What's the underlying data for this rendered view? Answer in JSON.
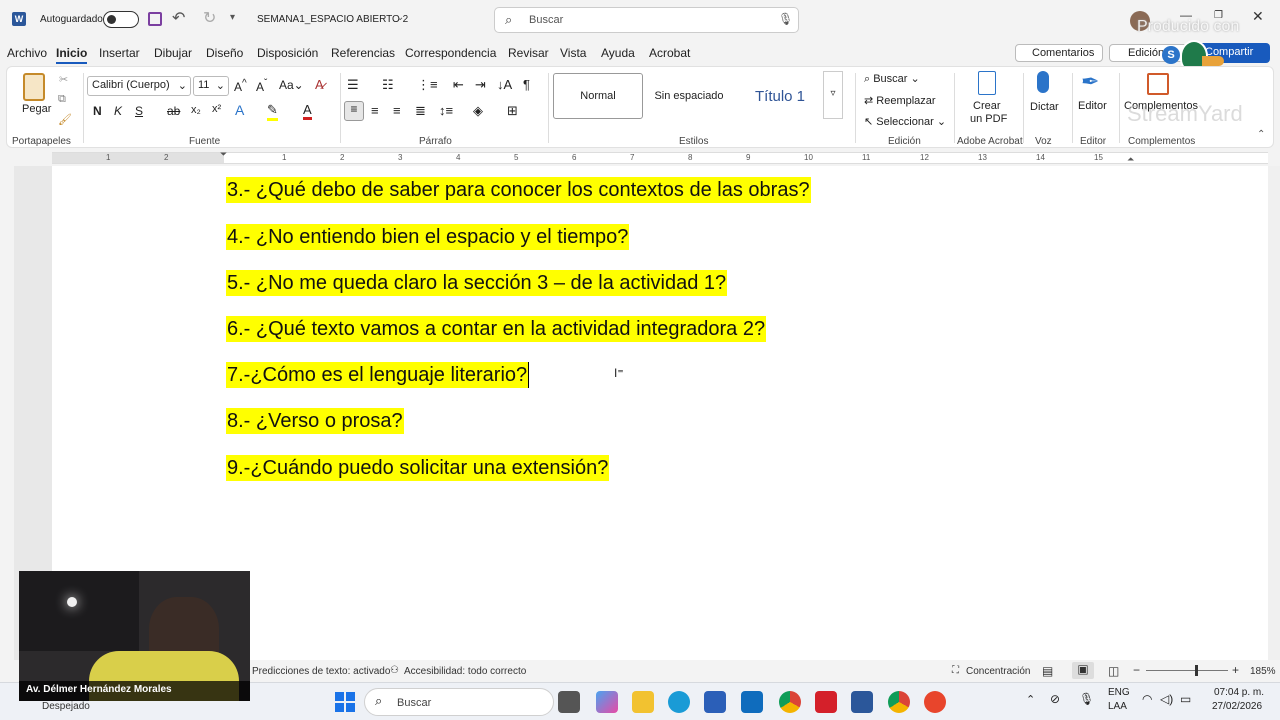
{
  "titlebar": {
    "autosave_label": "Autoguardado",
    "doc_title": "SEMANA1_ESPACIO ABIERTO 2",
    "search_placeholder": "Buscar",
    "watermark": "Producido con",
    "watermark2": "StreamYard"
  },
  "menu": [
    "Archivo",
    "Inicio",
    "Insertar",
    "Dibujar",
    "Diseño",
    "Disposición",
    "Referencias",
    "Correspondencia",
    "Revisar",
    "Vista",
    "Ayuda",
    "Acrobat"
  ],
  "menu_right": {
    "comments": "Comentarios",
    "editing": "Edición",
    "share": "Compartir"
  },
  "ribbon": {
    "paste": "Pegar",
    "clipboard_group": "Portapapeles",
    "font_name": "Calibri (Cuerpo)",
    "font_size": "11",
    "font_group": "Fuente",
    "paragraph_group": "Párrafo",
    "styles": [
      "Normal",
      "Sin espaciado",
      "Título 1"
    ],
    "styles_group": "Estilos",
    "find": "Buscar",
    "replace": "Reemplazar",
    "select": "Seleccionar",
    "editing_group": "Edición",
    "create_pdf_1": "Crear",
    "create_pdf_2": "un PDF",
    "acrobat_group": "Adobe Acrobat",
    "dictate": "Dictar",
    "voice_group": "Voz",
    "editor": "Editor",
    "editor_group": "Editor",
    "addins": "Complementos",
    "addins_group": "Complementos"
  },
  "ruler_numbers": [
    "1",
    "2",
    "1",
    "2",
    "3",
    "4",
    "5",
    "6",
    "7",
    "8",
    "9",
    "10",
    "11",
    "12",
    "13",
    "14",
    "15"
  ],
  "document": {
    "lines": [
      "3.- ¿Qué debo de saber para conocer los contextos de las obras?",
      "4.- ¿No entiendo bien el espacio y el tiempo?",
      "5.- ¿No me queda claro la sección 3 – de la actividad 1?",
      "6.- ¿Qué texto vamos a contar en la actividad integradora 2?",
      "7.-¿Cómo es el lenguaje literario?",
      "8.- ¿Verso o prosa?",
      "9.-¿Cuándo puedo solicitar una extensión?"
    ]
  },
  "statusbar": {
    "text_predictions": "Predicciones de texto: activado",
    "accessibility": "Accesibilidad: todo correcto",
    "focus": "Concentración",
    "zoom": "185%"
  },
  "webcam": {
    "name": "Av. Délmer Hernández Morales"
  },
  "taskbar": {
    "weather": "Despejado",
    "search": "Buscar",
    "lang_1": "ENG",
    "lang_2": "LAA",
    "time": "07:04 p. m.",
    "date": "27/02/2026"
  },
  "colors": {
    "accent": "#185abd",
    "highlight": "#ffff00",
    "word_blue": "#2b579a"
  }
}
